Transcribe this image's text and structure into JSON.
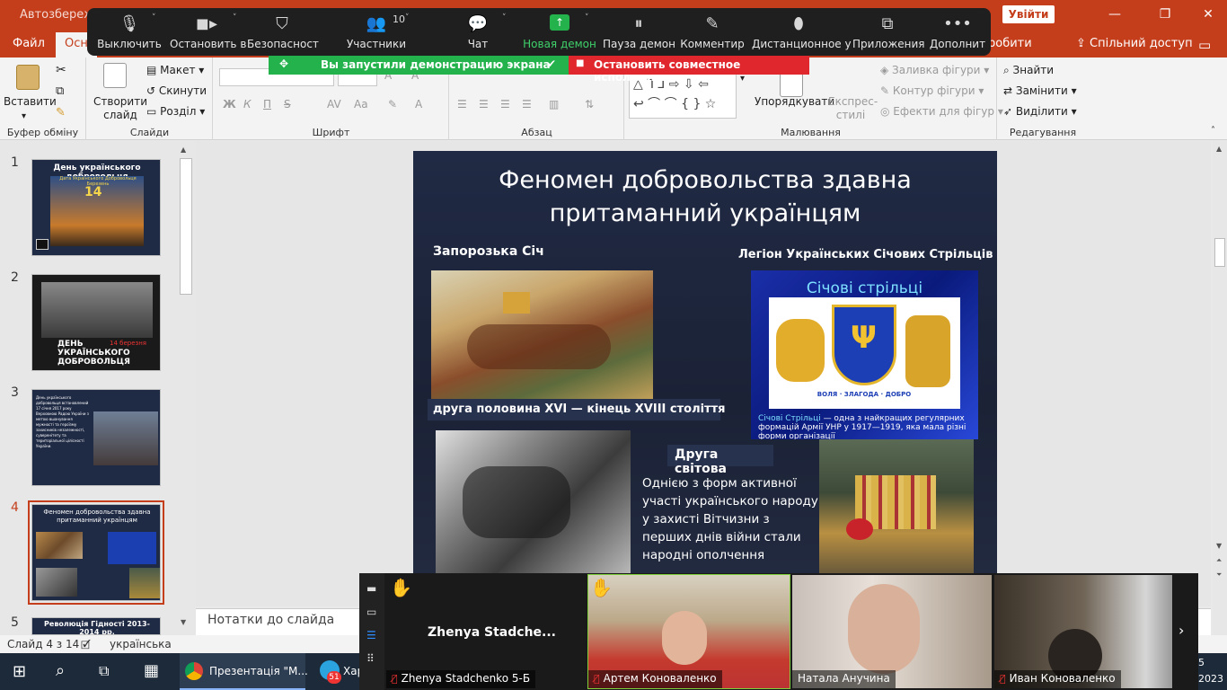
{
  "window": {
    "doc_title": "Автозбереже",
    "sign_in": "Увійти",
    "share_label": "Спільний доступ",
    "controls": [
      "—",
      "❐",
      "✕"
    ]
  },
  "tabs": [
    {
      "label": "Файл"
    },
    {
      "label": "Осн"
    },
    {
      "label": "робити"
    }
  ],
  "zoom": {
    "participants_count": "10",
    "items": [
      {
        "label": "Выключить",
        "icon": "microphone-icon"
      },
      {
        "label": "Остановить в",
        "icon": "video-camera-icon"
      },
      {
        "label": "Безопасност",
        "icon": "shield-icon"
      },
      {
        "label": "Участники",
        "icon": "participants-icon"
      },
      {
        "label": "Чат",
        "icon": "chat-icon"
      },
      {
        "label": "Новая демон",
        "icon": "share-screen-icon"
      },
      {
        "label": "Пауза демон",
        "icon": "pause-icon"
      },
      {
        "label": "Комментир",
        "icon": "pen-icon"
      },
      {
        "label": "Дистанционное у",
        "icon": "mouse-icon"
      },
      {
        "label": "Приложения",
        "icon": "apps-icon"
      },
      {
        "label": "Дополнит",
        "icon": "more-icon"
      }
    ],
    "sharing_notice": "Вы запустили демонстрацию экрана",
    "stop_sharing": "Остановить совместное использование"
  },
  "ribbon": {
    "clipboard": {
      "paste": "Вставити",
      "group": "Буфер обміну"
    },
    "slides": {
      "new_slide": "Створити слайд",
      "layout": "Макет",
      "reset": "Скинути",
      "section": "Розділ",
      "group": "Слайди"
    },
    "font": {
      "group": "Шрифт",
      "bold": "Ж",
      "italic": "К",
      "underline": "П",
      "strike": "S",
      "spacing": "AV",
      "case": "Aa"
    },
    "paragraph": {
      "group": "Абзац"
    },
    "drawing": {
      "arrange": "Упорядкувати",
      "quick_styles": "Експрес-стилі",
      "fill": "Заливка фігури",
      "outline": "Контур фігури",
      "effects": "Ефекти для фігур",
      "group": "Малювання"
    },
    "editing": {
      "find": "Знайти",
      "replace": "Замінити",
      "select": "Виділити",
      "group": "Редагування"
    }
  },
  "thumbnails": [
    {
      "num": "1",
      "title": "День українського добровольця",
      "sub": "Дата Українського Добровольця Березень",
      "day": "14"
    },
    {
      "num": "2",
      "title": "ДЕНЬ УКРАЇНСЬКОГО ДОБРОВОЛЬЦЯ",
      "date": "14 березня"
    },
    {
      "num": "3",
      "text": "День українського добровольця встановлений 17 січня 2017 року Верховною Радою України з метою вшанування мужності та героїзму захисників незалежності, суверенітету та територіальної цілісності України."
    },
    {
      "num": "4",
      "title": "Феномен добровольства здавна притаманний українцям"
    },
    {
      "num": "5",
      "title": "Революція Гідності 2013-2014 рр."
    }
  ],
  "slide": {
    "title": "Феномен добровольства здавна притаманний українцям",
    "left_heading": "Запорозька Січ",
    "right_heading": "Легіон Українських Січових Стрільців",
    "period_caption": "друга половина XVI — кінець XVIII століття",
    "sich_banner": "Січові стрільці",
    "emblem_motto": "ВОЛЯ · ЗЛАГОДА · ДОБРО",
    "sich_caption_lead": "Січові Стрільці",
    "sich_caption": " — одна з найкращих регулярних формацій Армії УНР у 1917—1919, яка мала різні форми організації",
    "ww2_heading": "Друга світова",
    "ww2_text": "Однією з форм активної участі українського народу у захисті Вітчизни з перших днів війни стали народні ополчення"
  },
  "notes": {
    "placeholder": "Нотатки до слайда"
  },
  "status": {
    "slide_of": "Слайд 4 з 14",
    "language": "українська"
  },
  "gallery": {
    "first_name": "Zhenya  Stadche...",
    "participants": [
      {
        "name": "Zhenya Stadchenko 5-Б"
      },
      {
        "name": "Артем Коноваленко"
      },
      {
        "name": "Натала Анучина"
      },
      {
        "name": "Иван Коноваленко"
      }
    ]
  },
  "taskbar": {
    "app_label": "Презентація \"М...",
    "telegram_badge": "51",
    "app2": "Хар",
    "time": "5",
    "year": "2023"
  }
}
